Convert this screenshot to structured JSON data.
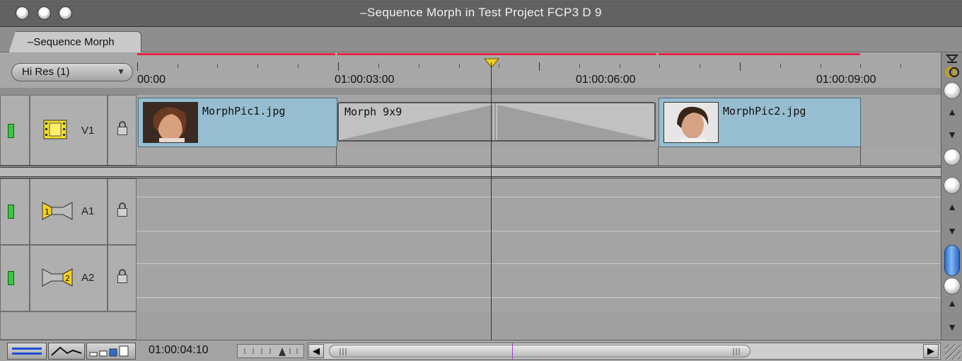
{
  "window": {
    "title": "–Sequence Morph in Test Project FCP3 D 9"
  },
  "tab": {
    "label": "–Sequence Morph"
  },
  "ruler": {
    "render_quality": "Hi Res  (1)",
    "timecodes": [
      "00:00",
      "01:00:03:00",
      "01:00:06:00",
      "01:00:09:00"
    ]
  },
  "tracks": {
    "v1": {
      "name": "V1"
    },
    "a1": {
      "name": "A1"
    },
    "a2": {
      "name": "A2"
    }
  },
  "clips": {
    "clip1": {
      "name": "MorphPic1.jpg"
    },
    "transition": {
      "name": "Morph 9x9"
    },
    "clip2": {
      "name": "MorphPic2.jpg"
    }
  },
  "bottom": {
    "current_timecode": "01:00:04:10"
  },
  "colors": {
    "clip_fill": "#97bdd0",
    "render_bar": "#e2254b",
    "track_enabled": "#36c83a",
    "scroller_thumb": "#2a6fd0"
  }
}
